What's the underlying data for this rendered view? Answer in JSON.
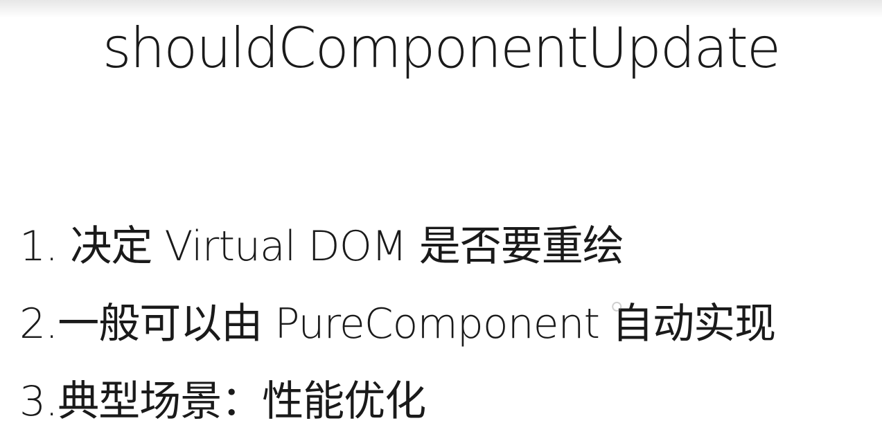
{
  "slide": {
    "title": "shouldComponentUpdate",
    "points": [
      "1. 决定 Virtual DOM 是否要重绘",
      "2.一般可以由 PureComponent 自动实现",
      "3.典型场景：性能优化"
    ]
  },
  "colors": {
    "background": "#ffffff",
    "text": "#1a1a1a"
  }
}
